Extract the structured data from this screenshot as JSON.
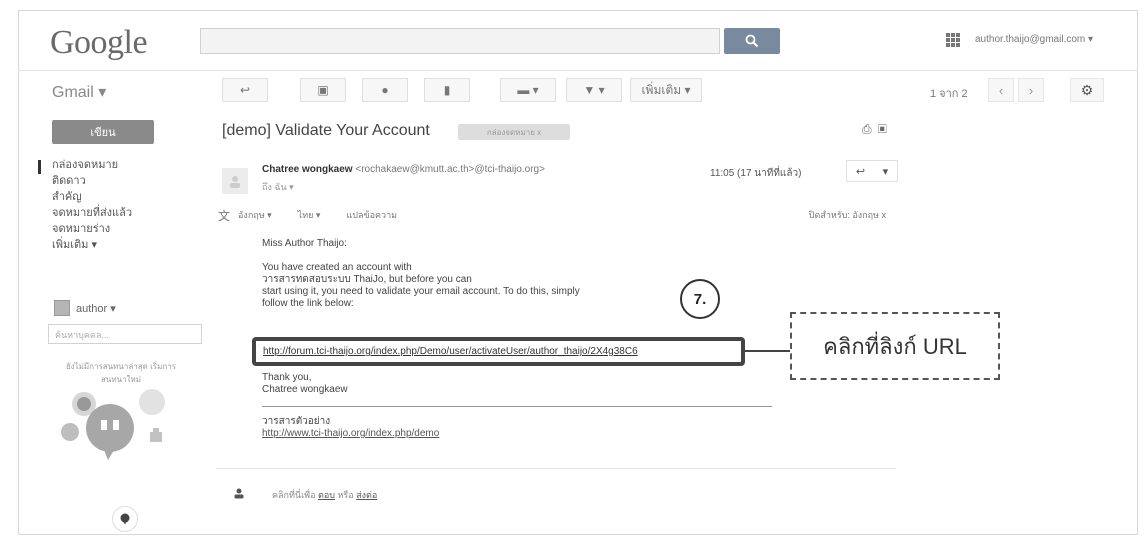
{
  "header": {
    "logo": "Google",
    "search_placeholder": "",
    "search_button_icon": "search-icon",
    "account": "author.thaijo@gmail.com ▾"
  },
  "toolbar": {
    "app_label": "Gmail ▾",
    "back": "↩",
    "archive": "▣",
    "spam": "●",
    "delete": "▮",
    "move": "▬ ▾",
    "labels": "▼ ▾",
    "more": "เพิ่มเติม ▾",
    "pager": "1 จาก 2",
    "prev": "‹",
    "next": "›",
    "settings": "⚙"
  },
  "sidebar": {
    "compose": "เขียน",
    "items": [
      {
        "label": "กล่องจดหมาย"
      },
      {
        "label": "ติดดาว"
      },
      {
        "label": "สำคัญ"
      },
      {
        "label": "จดหมายที่ส่งแล้ว"
      },
      {
        "label": "จดหมายร่าง"
      },
      {
        "label": "เพิ่มเติม ▾"
      }
    ],
    "user": "author ▾",
    "search_placeholder": "ค้นหาบุคคล...",
    "hangouts_tip": "ยังไม่มีการสนทนาล่าสุด เริ่มการสนทนาใหม่"
  },
  "message": {
    "subject": "[demo] Validate Your Account",
    "label": "กล่องจดหมาย x",
    "sender_name": "Chatree wongkaew",
    "sender_address": "<rochakaew@kmutt.ac.th>@tci-thaijo.org>",
    "to_me": "ถึง ฉัน ▾",
    "time": "11:05 (17 นาทีที่แล้ว)",
    "reply_icon": "↩",
    "reply_more": "▾",
    "translate": {
      "from": "อังกฤษ ▾",
      "to": "ไทย ▾",
      "action": "แปลข้อความ",
      "off": "ปิดสำหรับ: อังกฤษ x"
    },
    "greeting": "Miss Author Thaijo:",
    "body_lines": [
      "You have created an account with",
      "วารสารทดสอบระบบ ThaiJo, but before you can",
      "start using it, you need to validate your email account. To do this, simply",
      "follow the link below:"
    ],
    "link": "http://forum.tci-thaijo.org/index.php/Demo/user/activateUser/author_thaijo/2X4g38C6",
    "thanks": "Thank you,",
    "signature": "Chatree wongkaew",
    "journal_name": "วารสารตัวอย่าง",
    "journal_url": "http://www.tci-thaijo.org/index.php/demo",
    "reply_hint_prefix": "คลิกที่นี่เพื่อ",
    "reply_link": "ตอบ",
    "reply_hint_mid": "หรือ",
    "forward_link": "ส่งต่อ"
  },
  "annotation": {
    "step": "7.",
    "callout": "คลิกที่ลิงก์ URL"
  }
}
